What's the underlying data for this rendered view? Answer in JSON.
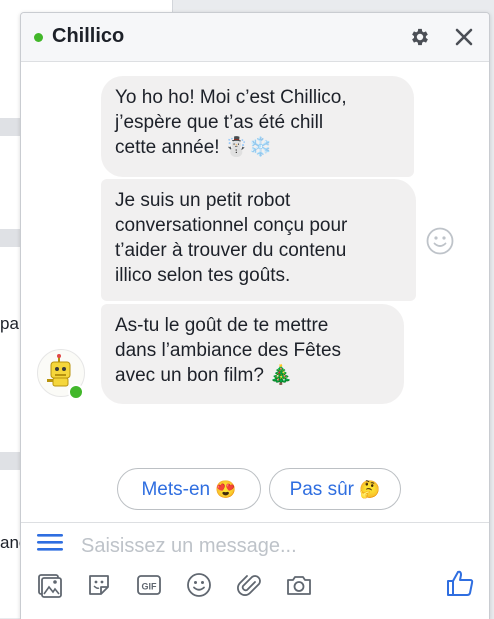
{
  "background": {
    "fragments": [
      "pa",
      "ane"
    ]
  },
  "chat": {
    "title": "Chillico",
    "status": "online",
    "header_icons": [
      "gear-icon",
      "close-icon"
    ],
    "messages": [
      {
        "text": "Yo ho ho! Moi c’est Chillico,\nj’espère que t’as été chill\ncette année! ☃️❄️"
      },
      {
        "text": "Je suis un petit robot\nconversationnel conçu pour\nt’aider à trouver du contenu\nillico selon tes goûts."
      },
      {
        "text": "As-tu le goût de te mettre\ndans l’ambiance des Fêtes\navec un bon film? 🎄"
      }
    ],
    "quick_replies": [
      {
        "label": "Mets-en",
        "emoji": "😍"
      },
      {
        "label": "Pas sûr",
        "emoji": "🤔"
      }
    ],
    "composer": {
      "placeholder": "Saisissez un message...",
      "value": ""
    },
    "toolbar_icons": [
      "image-icon",
      "sticker-icon",
      "gif-icon",
      "emoji-icon",
      "attachment-icon",
      "camera-icon",
      "like-icon"
    ],
    "colors": {
      "accent": "#2f6ee0",
      "online": "#42b72a",
      "bubble": "#f1f0f0"
    }
  }
}
